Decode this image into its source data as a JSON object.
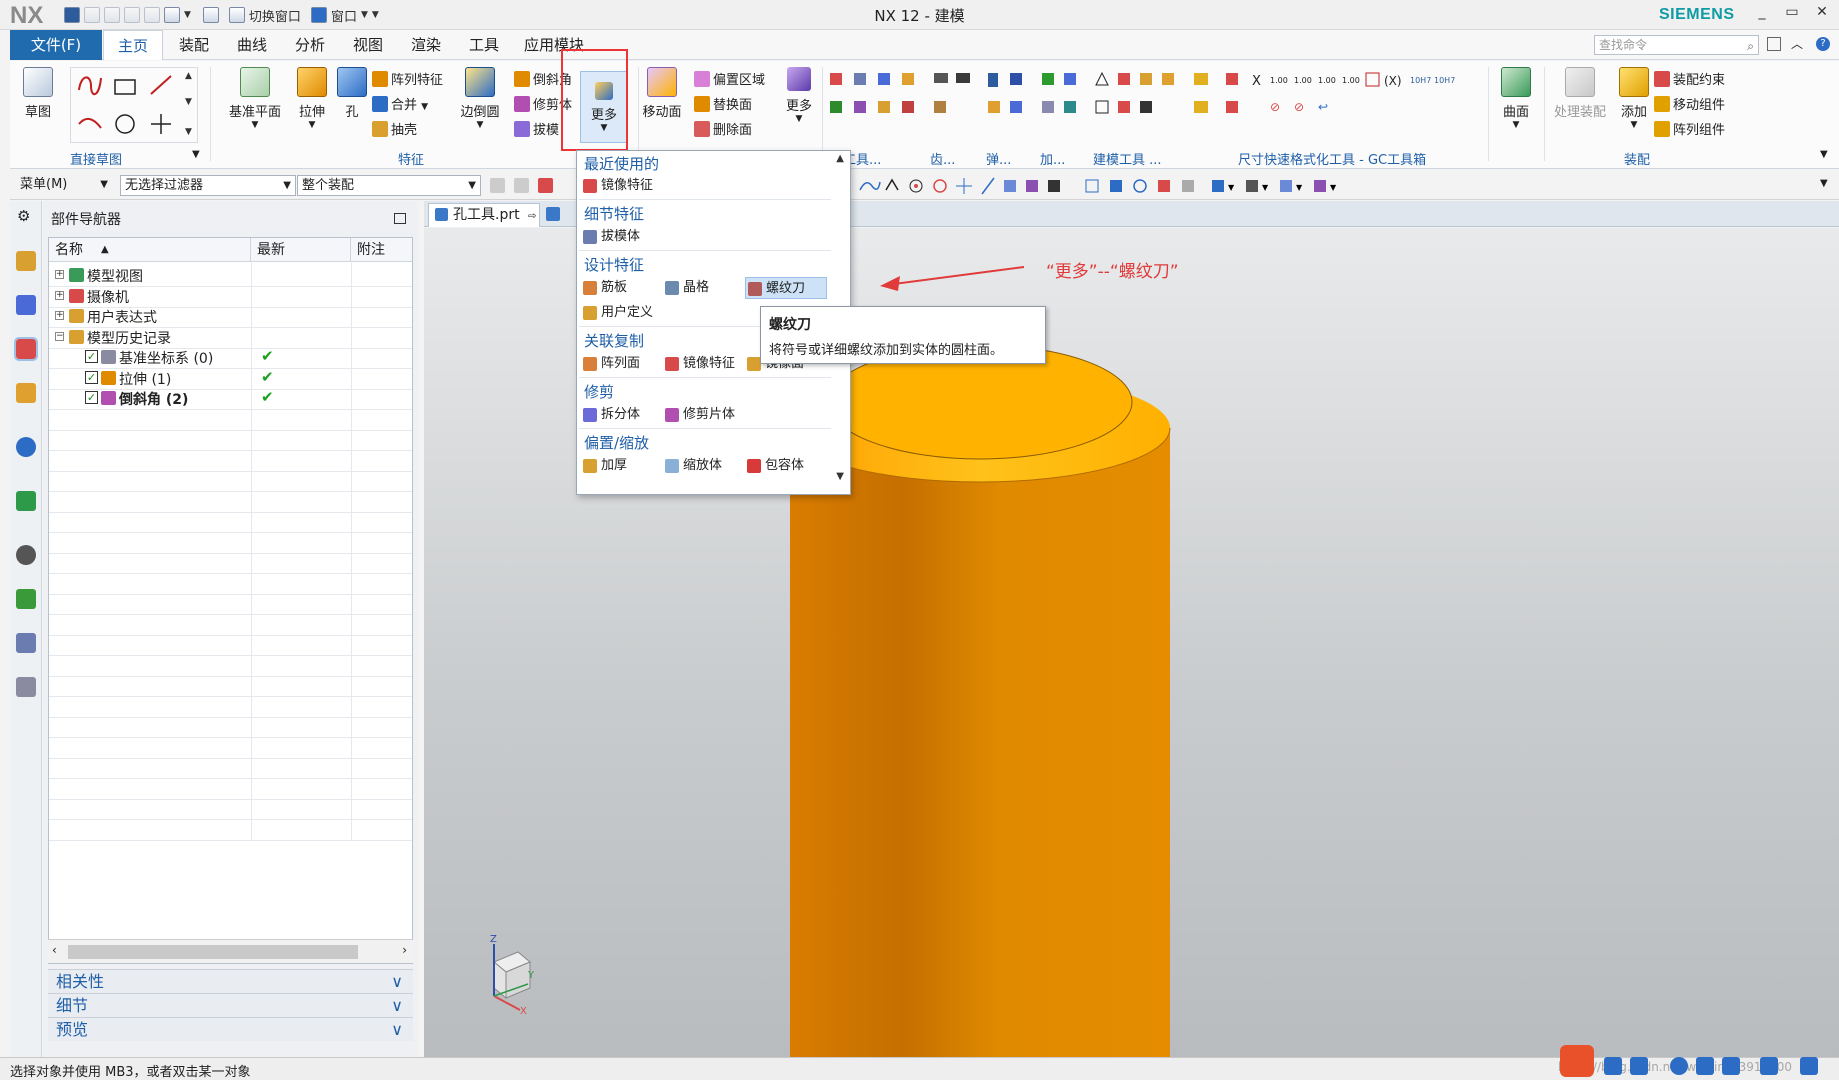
{
  "app": {
    "logo": "NX",
    "title": "NX 12 - 建模",
    "brand": "SIEMENS",
    "quick_access": {
      "switch_window": "切换窗口",
      "window": "窗口"
    },
    "window_controls": [
      "_",
      "▭",
      "✕"
    ]
  },
  "menu": {
    "file": "文件(F)",
    "tabs": [
      "主页",
      "装配",
      "曲线",
      "分析",
      "视图",
      "渲染",
      "工具",
      "应用模块"
    ],
    "active_tab": "主页",
    "search_placeholder": "查找命令"
  },
  "ribbon": {
    "direct_sketch": {
      "sketch": "草图",
      "group_label": "直接草图"
    },
    "feature": {
      "datum_plane": "基准平面",
      "extrude": "拉伸",
      "hole": "孔",
      "pattern_feature": "阵列特征",
      "unite": "合并",
      "shell": "抽壳",
      "edge_blend": "边倒圆",
      "chamfer": "倒斜角",
      "trim_body": "修剪体",
      "draft": "拔模",
      "more": "更多",
      "group_label": "特征"
    },
    "sync": {
      "move_face": "移动面",
      "offset_region": "偏置区域",
      "replace_face": "替换面",
      "delete_face": "删除面",
      "more": "更多"
    },
    "partial_groups": [
      "化工具...",
      "齿...",
      "弹...",
      "加...",
      "建模工具 ...",
      "尺寸快速格式化工具 - GC工具箱"
    ],
    "surface": {
      "label": "曲面"
    },
    "assembly": {
      "process_assembly": "处理装配",
      "add": "添加",
      "assembly_constraint": "装配约束",
      "move_component": "移动组件",
      "pattern_component": "阵列组件",
      "group_label": "装配"
    }
  },
  "toolbar2": {
    "menu": "菜单(M)",
    "filter": "无选择过滤器",
    "scope": "整个装配"
  },
  "navigator": {
    "title": "部件导航器",
    "columns": [
      "名称",
      "最新",
      "附注"
    ],
    "rows": [
      {
        "label": "模型视图",
        "expander": "+",
        "checked": false,
        "newest": ""
      },
      {
        "label": "摄像机",
        "expander": "+",
        "checked": false,
        "newest": ""
      },
      {
        "label": "用户表达式",
        "expander": "+",
        "checked": false,
        "newest": ""
      },
      {
        "label": "模型历史记录",
        "expander": "−",
        "checked": false,
        "newest": ""
      },
      {
        "label": "基准坐标系 (0)",
        "expander": "",
        "checked": true,
        "newest": "✔"
      },
      {
        "label": "拉伸 (1)",
        "expander": "",
        "checked": true,
        "newest": "✔"
      },
      {
        "label": "倒斜角 (2)",
        "expander": "",
        "checked": true,
        "newest": "✔"
      }
    ],
    "panels": [
      "相关性",
      "细节",
      "预览"
    ]
  },
  "document": {
    "tab": "孔工具.prt"
  },
  "more_menu": {
    "sections": [
      {
        "title": "最近使用的",
        "items": [
          "镜像特征"
        ]
      },
      {
        "title": "细节特征",
        "items": [
          "拔模体"
        ]
      },
      {
        "title": "设计特征",
        "items": [
          "筋板",
          "晶格",
          "螺纹刀",
          "用户定义"
        ]
      },
      {
        "title": "关联复制",
        "items": [
          "阵列面",
          "镜像特征",
          "镜像面"
        ]
      },
      {
        "title": "修剪",
        "items": [
          "拆分体",
          "修剪片体"
        ]
      },
      {
        "title": "偏置/缩放",
        "items": [
          "加厚",
          "缩放体",
          "包容体"
        ]
      }
    ],
    "highlighted": "螺纹刀"
  },
  "tooltip": {
    "title": "螺纹刀",
    "description": "将符号或详细螺纹添加到实体的圆柱面。"
  },
  "annotation": "“更多”--“螺纹刀”",
  "triad": {
    "z": "Z",
    "x": "X",
    "y": "Y"
  },
  "status": {
    "message": "选择对象并使用 MB3，或者双击某一对象"
  },
  "watermark": "https://blog.csdn.net/weixin_43912000",
  "colors": {
    "accent": "#1f6bad",
    "highlight_box": "#ee3535",
    "cylinder": "#e08a00",
    "cylinder_top": "#ffb300",
    "annotation": "#e03a3a"
  }
}
